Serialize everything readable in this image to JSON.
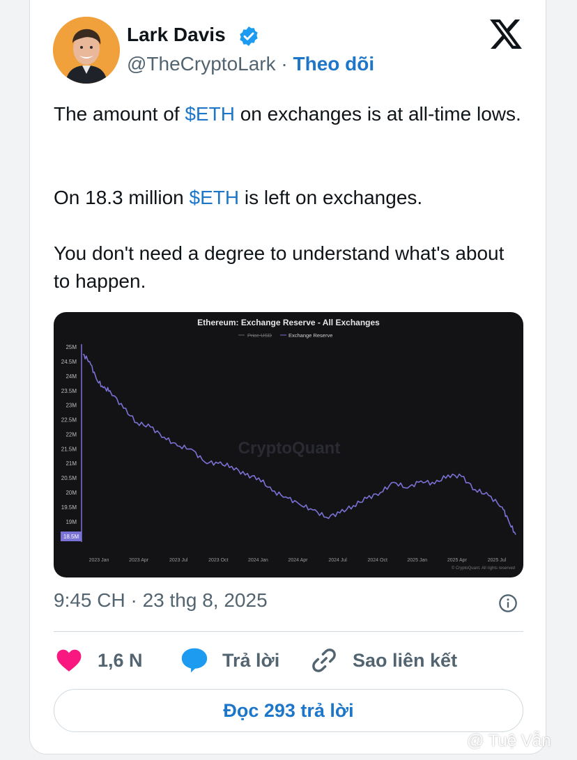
{
  "author": {
    "name": "Lark Davis",
    "handle": "@TheCryptoLark",
    "separator": "·",
    "follow_label": "Theo dõi"
  },
  "tweet": {
    "p1_before": "The amount of ",
    "p1_cashtag": "$ETH",
    "p1_after": " on exchanges is at all-time lows.",
    "p2_before": "On 18.3 million ",
    "p2_cashtag": "$ETH",
    "p2_after": " is left on exchanges.",
    "p3": "You don't need a degree to understand what's about to happen."
  },
  "chart_data": {
    "type": "line",
    "title": "Ethereum: Exchange Reserve - All Exchanges",
    "legend": [
      "Price USD",
      "Exchange Reserve"
    ],
    "watermark": "CryptoQuant",
    "credit": "© CryptoQuant. All rights reserved",
    "current_value_label": "18.5M",
    "y_ticks": [
      "25M",
      "24.5M",
      "24M",
      "23.5M",
      "23M",
      "22.5M",
      "22M",
      "21.5M",
      "21M",
      "20.5M",
      "20M",
      "19.5M",
      "19M"
    ],
    "x_ticks": [
      "2023 Jan",
      "2023 Apr",
      "2023 Jul",
      "2023 Oct",
      "2024 Jan",
      "2024 Apr",
      "2024 Jul",
      "2024 Oct",
      "2025 Jan",
      "2025 Apr",
      "2025 Jul"
    ],
    "ylim": [
      18.3,
      25.1
    ],
    "series": [
      {
        "name": "Exchange Reserve",
        "color": "#7b72d6",
        "x": [
          0,
          0.5,
          1,
          1.5,
          2,
          3,
          4,
          5,
          6,
          7,
          8,
          9,
          10,
          11,
          12,
          13,
          14,
          15,
          16,
          17,
          18,
          19,
          20,
          21,
          22,
          23,
          24,
          25,
          26,
          27,
          28,
          29,
          30,
          31,
          31.5,
          32
        ],
        "values": [
          24.75,
          24.5,
          23.9,
          23.6,
          23.5,
          22.9,
          22.4,
          22.25,
          21.9,
          21.6,
          21.5,
          21.05,
          21.0,
          20.9,
          20.6,
          20.5,
          20.05,
          19.85,
          19.6,
          19.4,
          19.15,
          19.3,
          19.55,
          19.8,
          20.0,
          20.35,
          20.15,
          20.4,
          20.3,
          20.6,
          20.55,
          20.1,
          19.9,
          19.5,
          19.0,
          18.55
        ]
      }
    ]
  },
  "footer": {
    "timestamp": "9:45 CH · 23 thg 8, 2025",
    "like_count": "1,6 N",
    "reply_label": "Trả lời",
    "copy_link_label": "Sao liên kết",
    "read_replies_label": "Đọc 293 trả lời"
  },
  "watermark": "@ Tuệ Vẫn"
}
